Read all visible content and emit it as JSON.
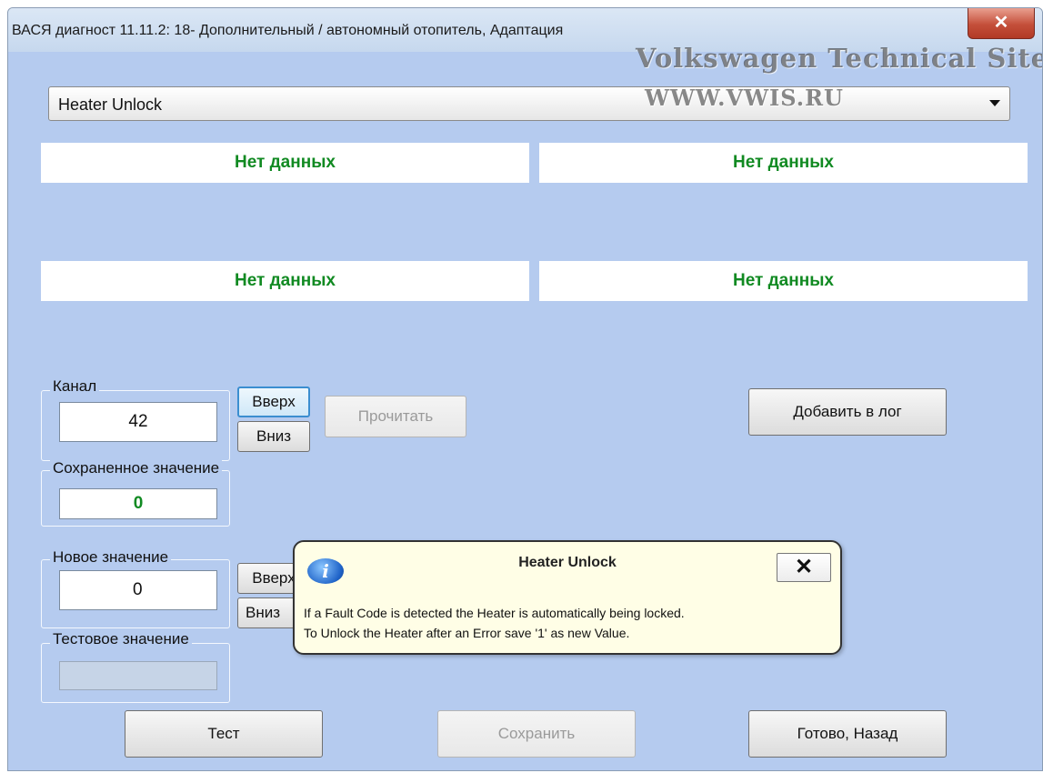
{
  "window": {
    "title": "ВАСЯ диагност 11.11.2: 18- Дополнительный / автономный отопитель, Адаптация",
    "close_glyph": "✕"
  },
  "watermark": {
    "line1": "Volkswagen Technical Site",
    "line2": "WWW.VWIS.RU"
  },
  "adaptation_select": {
    "value": "Heater Unlock"
  },
  "data_boxes": [
    "Нет данных",
    "Нет данных",
    "Нет данных",
    "Нет данных"
  ],
  "channel": {
    "label": "Канал",
    "value": "42",
    "up_label": "Вверх",
    "down_label": "Вниз",
    "read_label": "Прочитать"
  },
  "stored_value": {
    "label": "Сохраненное значение",
    "value": "0",
    "color": "#118a22"
  },
  "new_value": {
    "label": "Новое значение",
    "value": "0",
    "up_label": "Вверх",
    "down_label": "Вниз"
  },
  "test_value": {
    "label": "Тестовое значение",
    "value": ""
  },
  "buttons": {
    "add_to_log": "Добавить в лог",
    "test": "Тест",
    "save": "Сохранить",
    "done_back": "Готово, Назад"
  },
  "balloon": {
    "icon": "info-icon",
    "icon_glyph": "i",
    "title": "Heater Unlock",
    "close_glyph": "✕",
    "line1": "If a Fault Code is detected the Heater is automatically being locked.",
    "line2": "To Unlock the Heater after an Error save '1' as new Value."
  }
}
